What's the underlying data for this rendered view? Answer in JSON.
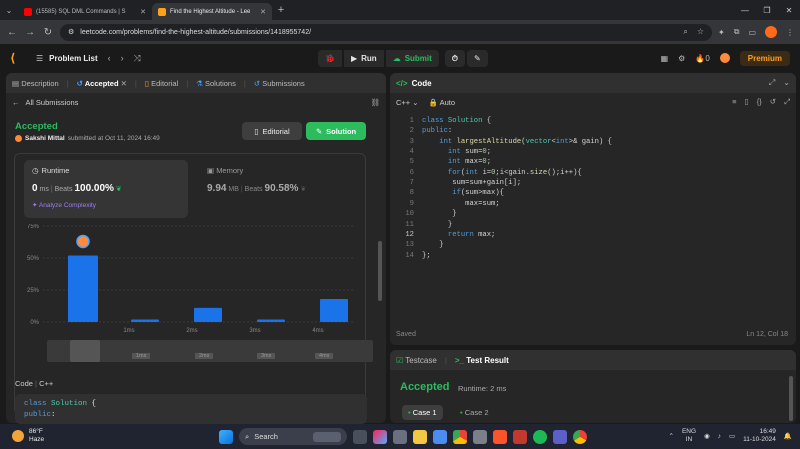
{
  "browser": {
    "tabs": [
      {
        "title": "(15585) SQL DML Commands | S",
        "color": "#ff0000"
      },
      {
        "title": "Find the Highest Altitude - Lee",
        "color": "#ffa116"
      }
    ],
    "url": "leetcode.com/problems/find-the-highest-altitude/submissions/1418955742/"
  },
  "header": {
    "problem_list": "Problem List",
    "run": "Run",
    "submit": "Submit",
    "streak": "0",
    "premium": "Premium"
  },
  "left_tabs": [
    "Description",
    "Accepted",
    "Editorial",
    "Solutions",
    "Submissions"
  ],
  "all_submissions": "All Submissions",
  "result": {
    "status": "Accepted",
    "user": "Sakshi Mittal",
    "submitted": "submitted at Oct 11, 2024 16:49",
    "editorial_btn": "Editorial",
    "solution_btn": "Solution"
  },
  "runtime": {
    "label": "Runtime",
    "value": "0",
    "unit": "ms",
    "beats_label": "Beats",
    "beats": "100.00%",
    "analyze": "Analyze Complexity"
  },
  "memory": {
    "label": "Memory",
    "value": "9.94",
    "unit": "MB",
    "beats_label": "Beats",
    "beats": "90.58%"
  },
  "chart_data": {
    "type": "bar",
    "yticks": [
      "75%",
      "50%",
      "25%",
      "0%"
    ],
    "ylim": [
      0,
      75
    ],
    "xticks": [
      "1ms",
      "2ms",
      "3ms",
      "4ms"
    ],
    "values": [
      52,
      2,
      11,
      2,
      18
    ],
    "highlight_index": 0,
    "color": "#1a73e8"
  },
  "scroll_ticks": [
    "1ms",
    "2ms",
    "3ms",
    "4ms"
  ],
  "code_section": {
    "label": "Code",
    "lang": "C++",
    "lines": [
      "class Solution {",
      "public:"
    ]
  },
  "editor": {
    "title": "Code",
    "lang": "C++",
    "mode": "Auto",
    "status": "Saved",
    "position": "Ln 12, Col 18"
  },
  "testpanel": {
    "tab1": "Testcase",
    "tab2": "Test Result",
    "status": "Accepted",
    "runtime": "Runtime: 2 ms",
    "case1": "Case 1",
    "case2": "Case 2"
  },
  "taskbar": {
    "temp": "86°F",
    "weather": "Haze",
    "search": "Search",
    "lang1": "ENG",
    "lang2": "IN",
    "time": "16:49",
    "date": "11-10-2024"
  }
}
